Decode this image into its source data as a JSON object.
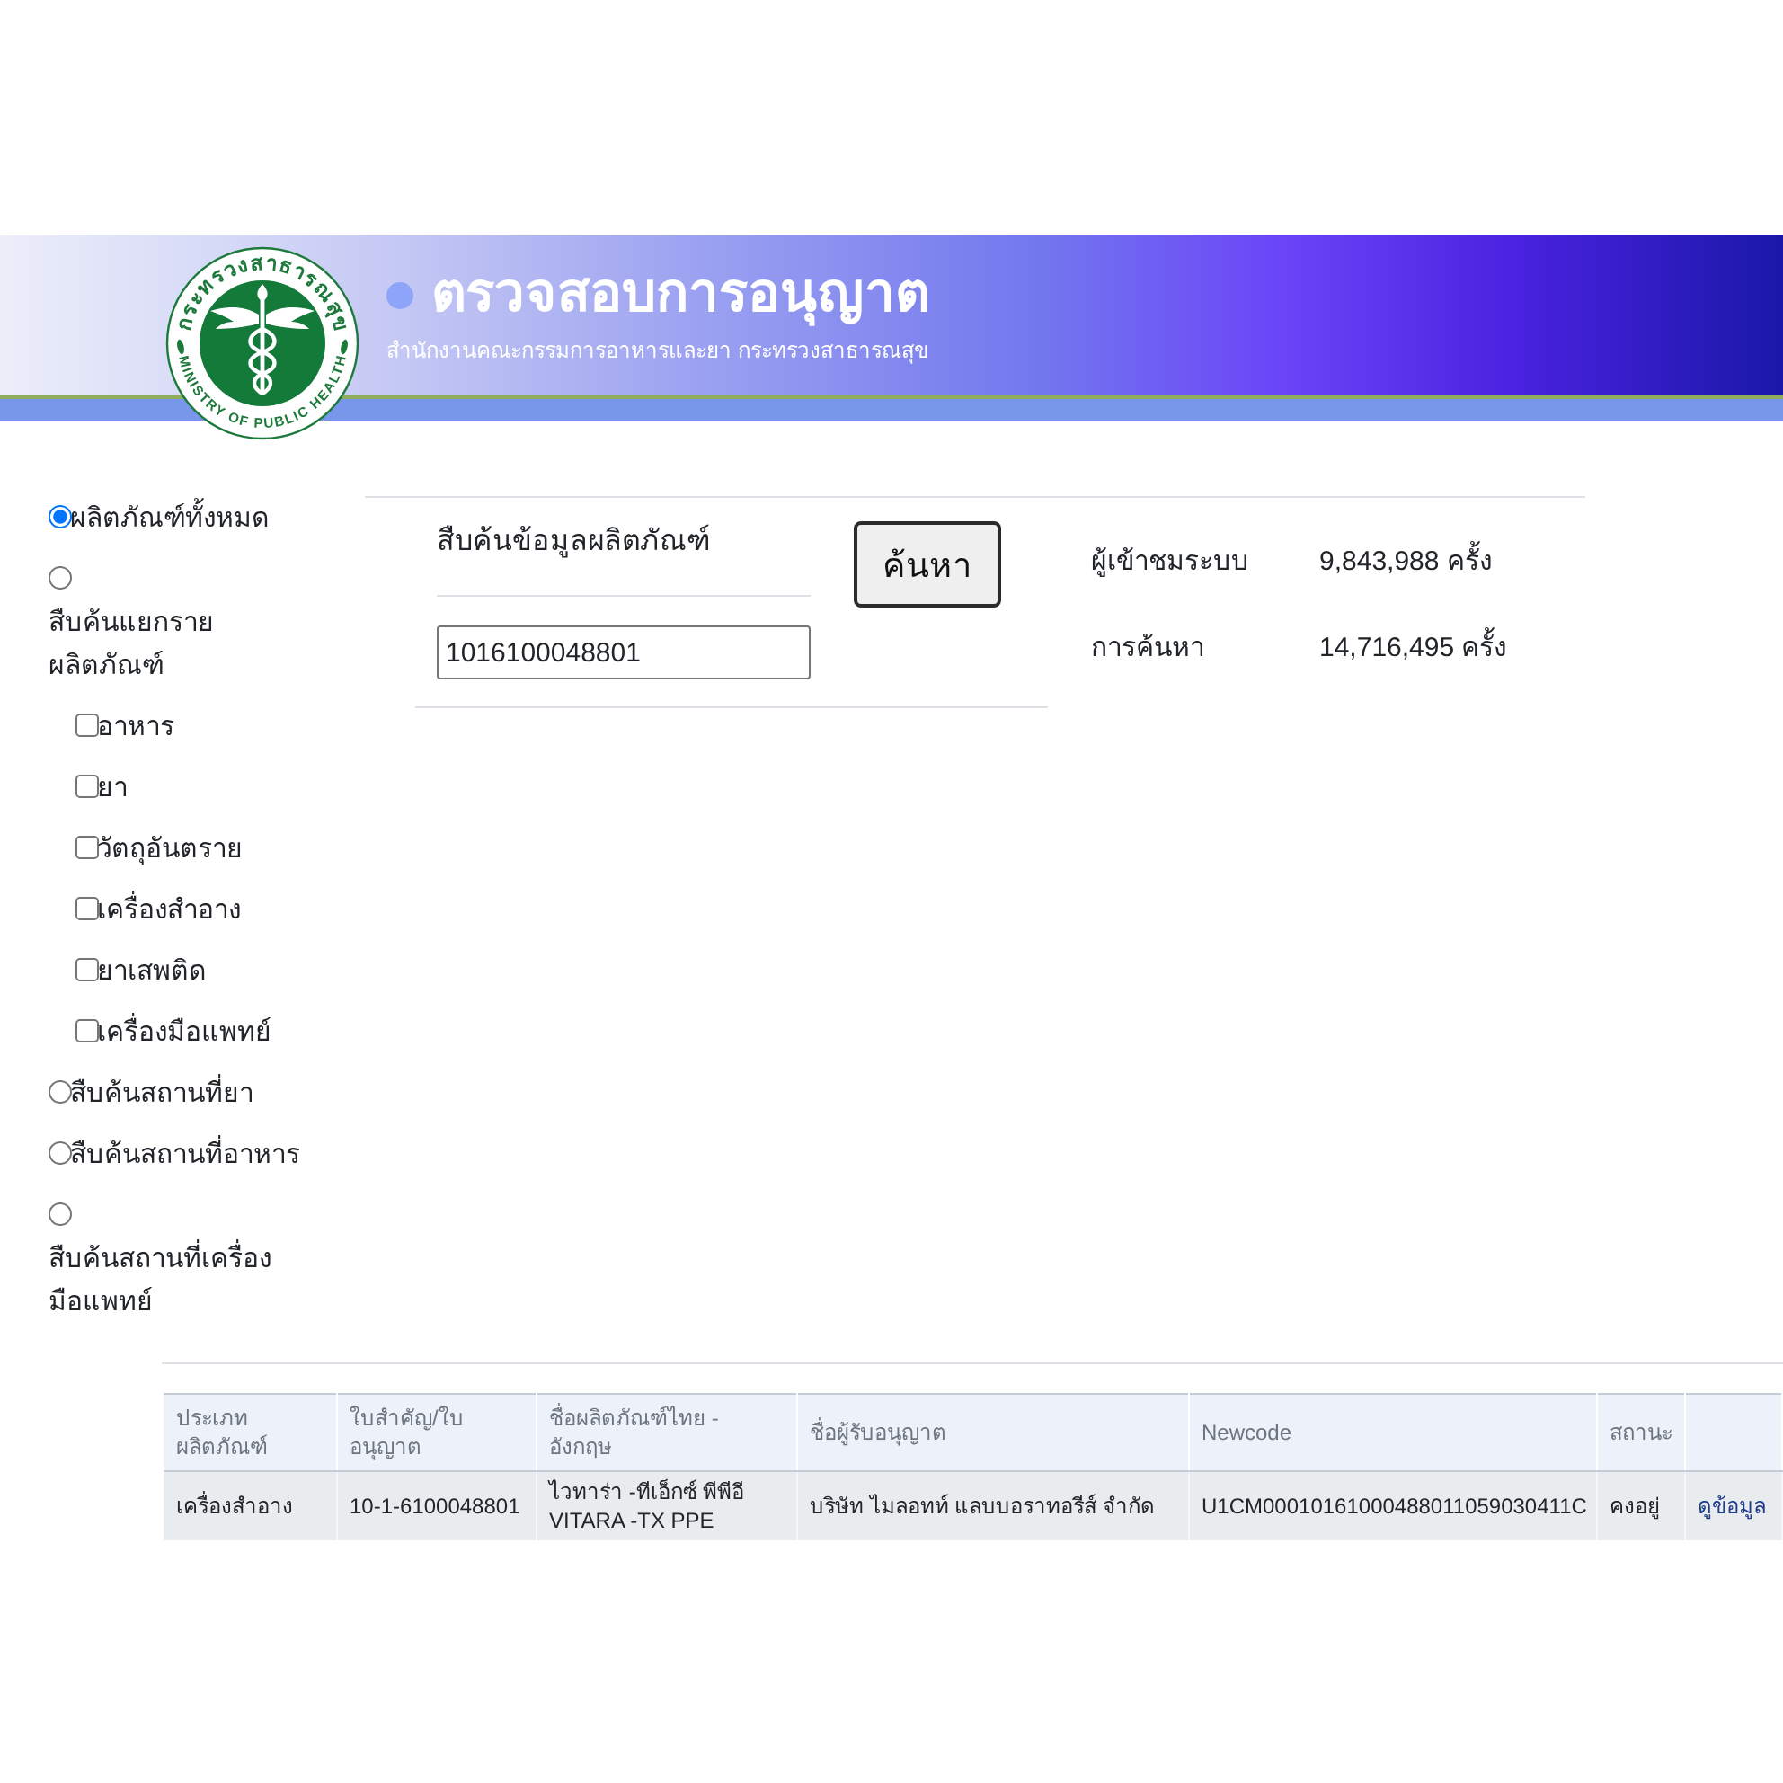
{
  "header": {
    "title": "ตรวจสอบการอนุญาต",
    "subtitle": "สำนักงานคณะกรรมการอาหารและยา กระทรวงสาธารณสุข",
    "logo": {
      "top_text": "กระทรวงสาธารณสุข",
      "bottom_text": "MINISTRY OF PUBLIC HEALTH"
    }
  },
  "sidebar": {
    "options": [
      {
        "kind": "radio",
        "label": "ผลิตภัณฑ์ทั้งหมด",
        "selected": true
      },
      {
        "kind": "radio",
        "label": "สืบค้นแยกรายผลิตภัณฑ์",
        "selected": false,
        "children": [
          {
            "kind": "checkbox",
            "label": "อาหาร",
            "checked": false
          },
          {
            "kind": "checkbox",
            "label": "ยา",
            "checked": false
          },
          {
            "kind": "checkbox",
            "label": "วัตถุอันตราย",
            "checked": false
          },
          {
            "kind": "checkbox",
            "label": "เครื่องสำอาง",
            "checked": false
          },
          {
            "kind": "checkbox",
            "label": "ยาเสพติด",
            "checked": false
          },
          {
            "kind": "checkbox",
            "label": "เครื่องมือแพทย์",
            "checked": false
          }
        ]
      },
      {
        "kind": "radio",
        "label": "สืบค้นสถานที่ยา",
        "selected": false
      },
      {
        "kind": "radio",
        "label": "สืบค้นสถานที่อาหาร",
        "selected": false
      },
      {
        "kind": "radio",
        "label": "สืบค้นสถานที่เครื่องมือแพทย์",
        "selected": false
      }
    ]
  },
  "search": {
    "heading": "สืบค้นข้อมูลผลิตภัณฑ์",
    "value": "1016100048801",
    "button": "ค้นหา"
  },
  "stats": [
    {
      "label": "ผู้เข้าชมระบบ",
      "value": "9,843,988 ครั้ง"
    },
    {
      "label": "การค้นหา",
      "value": "14,716,495 ครั้ง"
    }
  ],
  "table": {
    "columns": [
      "ประเภทผลิตภัณฑ์",
      "ใบสำคัญ/ใบอนุญาต",
      "ชื่อผลิตภัณฑ์ไทย - อังกฤษ",
      "ชื่อผู้รับอนุญาต",
      "Newcode",
      "สถานะ"
    ],
    "rows": [
      {
        "cells": [
          "เครื่องสำอาง",
          "10-1-6100048801",
          "ไวทาร่า -ทีเอ็กซ์ พีพีอี VITARA -TX PPE",
          "บริษัท ไมลอทท์ แลบบอราทอรีส์ จำกัด",
          "U1CM00010161000488011059030411C",
          "คงอยู่"
        ],
        "link": "ดูข้อมูล"
      }
    ]
  }
}
